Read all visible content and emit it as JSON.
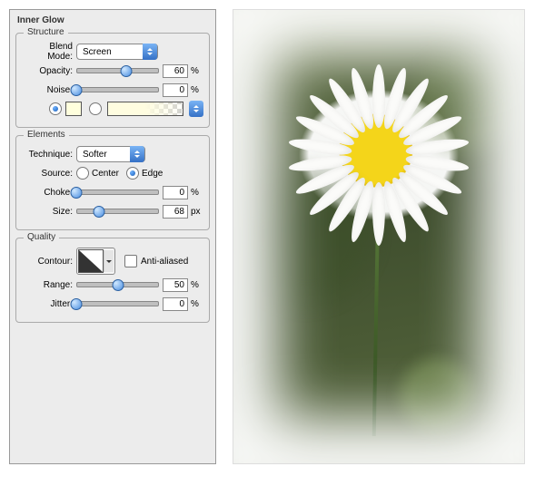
{
  "panel": {
    "title": "Inner Glow"
  },
  "structure": {
    "legend": "Structure",
    "blend_label": "Blend Mode:",
    "blend_value": "Screen",
    "opacity_label": "Opacity:",
    "opacity_value": "60",
    "opacity_unit": "%",
    "noise_label": "Noise:",
    "noise_value": "0",
    "noise_unit": "%"
  },
  "elements": {
    "legend": "Elements",
    "technique_label": "Technique:",
    "technique_value": "Softer",
    "source_label": "Source:",
    "center_label": "Center",
    "edge_label": "Edge",
    "choke_label": "Choke:",
    "choke_value": "0",
    "choke_unit": "%",
    "size_label": "Size:",
    "size_value": "68",
    "size_unit": "px"
  },
  "quality": {
    "legend": "Quality",
    "contour_label": "Contour:",
    "aa_label": "Anti-aliased",
    "range_label": "Range:",
    "range_value": "50",
    "range_unit": "%",
    "jitter_label": "Jitter:",
    "jitter_value": "0",
    "jitter_unit": "%"
  },
  "sliders": {
    "opacity_pct": 60,
    "noise_pct": 0,
    "choke_pct": 0,
    "size_pct": 27,
    "range_pct": 50,
    "jitter_pct": 0
  }
}
